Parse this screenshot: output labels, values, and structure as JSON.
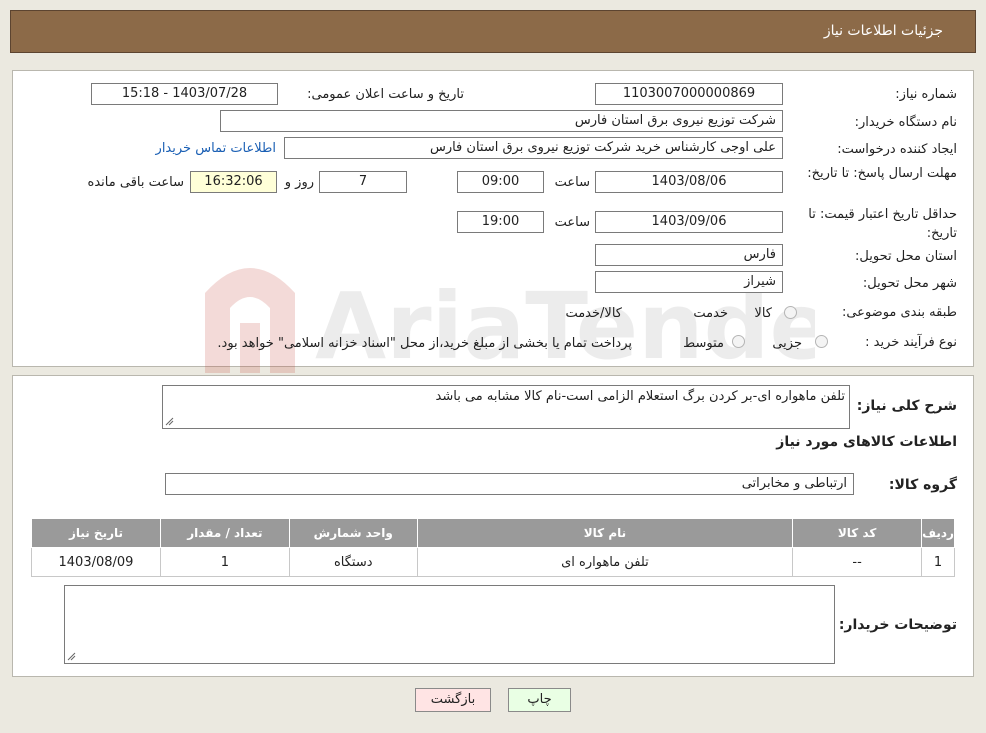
{
  "header": {
    "title": "جزئیات اطلاعات نیاز"
  },
  "form": {
    "need_number_label": "شماره نیاز:",
    "need_number": "1103007000000869",
    "announce_label": "تاریخ و ساعت اعلان عمومی:",
    "announce_value": "1403/07/28 - 15:18",
    "buyer_org_label": "نام دستگاه خریدار:",
    "buyer_org": "شرکت توزیع نیروی برق استان فارس",
    "creator_label": "ایجاد کننده درخواست:",
    "creator": "علی اوجی کارشناس خرید شرکت توزیع نیروی برق استان فارس",
    "contact_link": "اطلاعات تماس خریدار",
    "deadline_label": "مهلت ارسال پاسخ: تا تاریخ:",
    "deadline_date": "1403/08/06",
    "time_label": "ساعت",
    "deadline_time": "09:00",
    "days_value": "7",
    "days_label": "روز و",
    "remaining_time": "16:32:06",
    "remaining_label": "ساعت باقی مانده",
    "validity_label": "حداقل تاریخ اعتبار قیمت: تا تاریخ:",
    "validity_date": "1403/09/06",
    "validity_time": "19:00",
    "province_label": "استان محل تحویل:",
    "province": "فارس",
    "city_label": "شهر محل تحویل:",
    "city": "شیراز",
    "category_label": "طبقه بندی موضوعی:",
    "category_options": [
      "کالا",
      "خدمت",
      "کالا/خدمت"
    ],
    "process_label": "نوع فرآیند خرید :",
    "process_options": [
      "جزیی",
      "متوسط"
    ],
    "process_note": "پرداخت تمام یا بخشی از مبلغ خرید،از محل \"اسناد خزانه اسلامی\" خواهد بود."
  },
  "details": {
    "summary_label": "شرح کلی نیاز:",
    "summary": "تلفن ماهواره ای-بر کردن برگ استعلام الزامی است-نام کالا مشابه می باشد",
    "items_title": "اطلاعات کالاهای مورد نیاز",
    "group_label": "گروه کالا:",
    "group_value": "ارتباطی و مخابراتی",
    "table_headers": [
      "ردیف",
      "کد کالا",
      "نام کالا",
      "واحد شمارش",
      "تعداد / مقدار",
      "تاریخ نیاز"
    ],
    "table_rows": [
      [
        "1",
        "--",
        "تلفن ماهواره ای",
        "دستگاه",
        "1",
        "1403/08/09"
      ]
    ],
    "buyer_notes_label": "توضیحات خریدار:"
  },
  "buttons": {
    "print": "چاپ",
    "back": "بازگشت"
  },
  "watermark": {
    "text": "AriaTender.neT"
  },
  "colors": {
    "header": "#8c6a48",
    "link": "#1a5fb4",
    "table_header": "#9a9a9a",
    "print_bg": "#e9ffe4",
    "back_bg": "#ffe4e4"
  }
}
